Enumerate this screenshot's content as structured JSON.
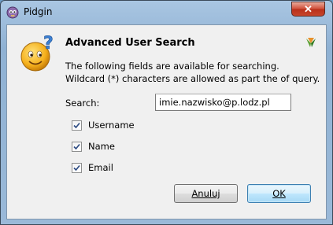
{
  "window": {
    "title": "Pidgin",
    "close_label": "✕"
  },
  "dialog": {
    "heading": "Advanced User Search",
    "description_line1": "The following fields are available for searching.",
    "description_line2": "Wildcard (*) characters are allowed as part the of query.",
    "search_label": "Search:",
    "search_value": "imie.nazwisko@p.lodz.pl",
    "options": [
      {
        "label": "Username",
        "checked": true
      },
      {
        "label": "Name",
        "checked": true
      },
      {
        "label": "Email",
        "checked": true
      }
    ],
    "cancel_label": "Anuluj",
    "ok_label": "OK"
  },
  "icons": {
    "app": "pidgin-icon",
    "dialog": "question-smiley-icon",
    "corner": "jabber-icon"
  },
  "colors": {
    "title_bar": "#9dbcdb",
    "close_button": "#c7452c",
    "ok_button_border": "#3c7fb1"
  }
}
